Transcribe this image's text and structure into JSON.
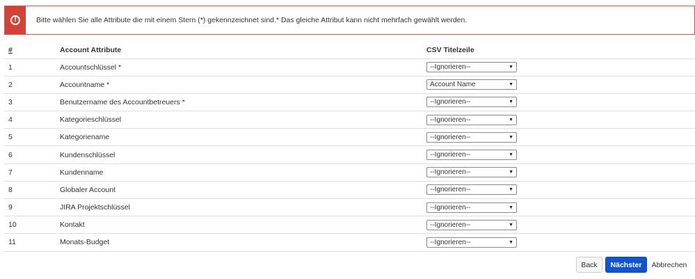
{
  "alert": {
    "icon": "exclamation-circle-icon",
    "icon_glyph": "!",
    "message": "Bitte wählen Sie alle Attribute die mit einem Stern (*) gekennzeichnet sind.* Das gleiche Attribut kann nicht mehrfach gewählt werden.",
    "color": "#d04437"
  },
  "table": {
    "headers": [
      "#",
      "Account Attribute",
      "CSV Titelzeile"
    ],
    "rows": [
      {
        "num": "1",
        "attribute": "Accountschlüssel *",
        "value": "--Ignorieren--"
      },
      {
        "num": "2",
        "attribute": "Accountname *",
        "value": "Account Name"
      },
      {
        "num": "3",
        "attribute": "Benutzername des Accountbetreuers *",
        "value": "--Ignorieren--"
      },
      {
        "num": "4",
        "attribute": "Kategorieschlüssel",
        "value": "--Ignorieren--"
      },
      {
        "num": "5",
        "attribute": "Kategoriename",
        "value": "--Ignorieren--"
      },
      {
        "num": "6",
        "attribute": "Kundenschlüssel",
        "value": "--Ignorieren--"
      },
      {
        "num": "7",
        "attribute": "Kundenname",
        "value": "--Ignorieren--"
      },
      {
        "num": "8",
        "attribute": "Globaler Account",
        "value": "--Ignorieren--"
      },
      {
        "num": "9",
        "attribute": "JIRA Projektschlüssel",
        "value": "--Ignorieren--"
      },
      {
        "num": "10",
        "attribute": "Kontakt",
        "value": "--Ignorieren--"
      },
      {
        "num": "11",
        "attribute": "Monats-Budget",
        "value": "--Ignorieren--"
      }
    ]
  },
  "buttons": {
    "back": "Back",
    "next": "Nächster",
    "cancel": "Abbrechen",
    "next_color": "#1155cc"
  },
  "icons": {
    "dropdown": "caret-down-icon",
    "dropdown_glyph": "▼"
  }
}
